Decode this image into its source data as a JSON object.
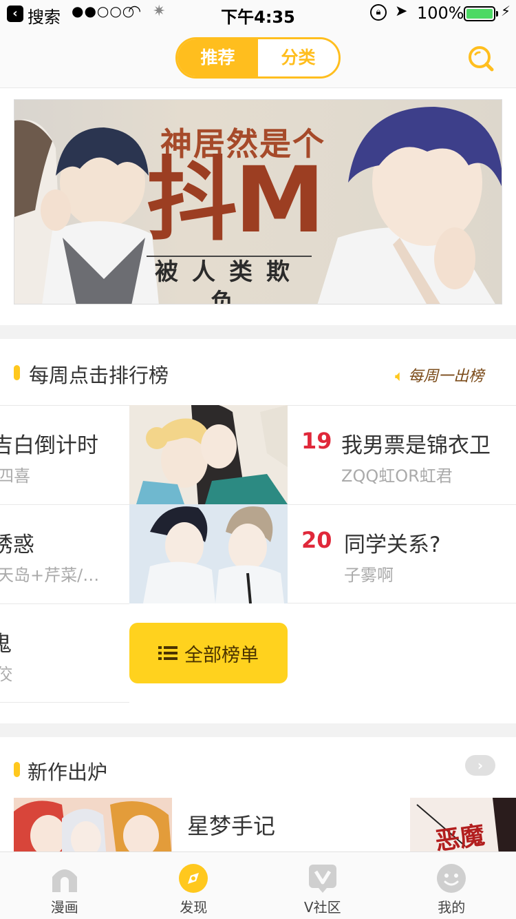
{
  "status_bar": {
    "back_label": "搜索",
    "signal": "●●○○○",
    "time": "下午4:35",
    "battery_pct": "100%",
    "battery_level": 1.0
  },
  "top_nav": {
    "tabs": [
      {
        "label": "推荐",
        "active": true
      },
      {
        "label": "分类",
        "active": false
      }
    ],
    "search_icon": "search-icon"
  },
  "banner": {
    "line1": "神居然是个",
    "line2": "抖M",
    "line3": "被人类欺负"
  },
  "ranking": {
    "title": "每周点击排行榜",
    "weekly_badge": "每周一出榜",
    "left_rows": [
      {
        "name": "吉白倒计时",
        "author": "四喜"
      },
      {
        "name": "诱惑",
        "author": "天岛+芹菜/…"
      },
      {
        "name": "鬼",
        "author": "佼"
      }
    ],
    "right_rows": [
      {
        "rank": "19",
        "name": "我男票是锦衣卫",
        "author": "ZQQ虹OR虹君"
      },
      {
        "rank": "20",
        "name": "同学关系?",
        "author": "子雾啊"
      }
    ],
    "all_button": "全部榜单"
  },
  "new_section": {
    "title": "新作出炉",
    "more_icon": "chevron-right-icon",
    "featured_title": "星梦手记",
    "side_cover_text": "恶魔"
  },
  "tab_bar": {
    "items": [
      {
        "label": "漫画",
        "icon": "house-icon",
        "active": false
      },
      {
        "label": "发现",
        "icon": "compass-icon",
        "active": true
      },
      {
        "label": "V社区",
        "icon": "v-community-icon",
        "active": false
      },
      {
        "label": "我的",
        "icon": "face-icon",
        "active": false
      }
    ]
  },
  "colors": {
    "accent": "#ffbe1e",
    "rank_red": "#e0283a",
    "button_yellow": "#ffd21e"
  }
}
